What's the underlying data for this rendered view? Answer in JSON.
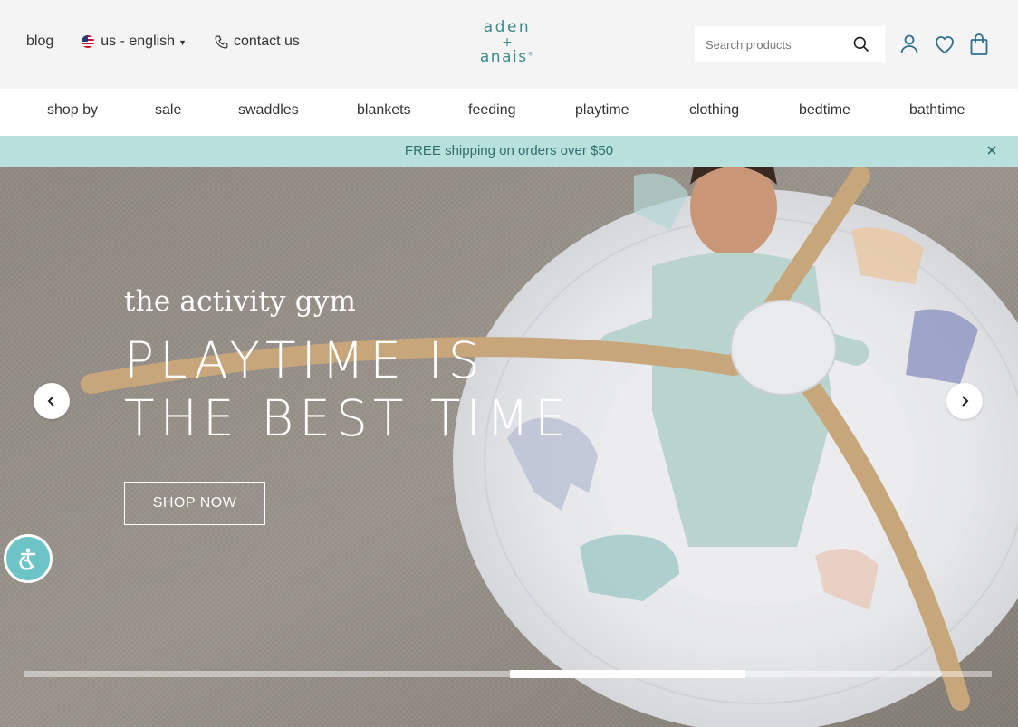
{
  "utility": {
    "blog": "blog",
    "locale": "us - english",
    "contact": "contact us"
  },
  "logo": {
    "line1": "aden",
    "line2": "+",
    "line3": "anais",
    "mark": "®"
  },
  "search": {
    "placeholder": "Search products",
    "icon": "search-icon"
  },
  "icons": {
    "account": "user-icon",
    "wishlist": "heart-icon",
    "cart": "shopping-bag-icon"
  },
  "nav": {
    "items": [
      {
        "label": "shop by"
      },
      {
        "label": "sale"
      },
      {
        "label": "swaddles"
      },
      {
        "label": "blankets"
      },
      {
        "label": "feeding"
      },
      {
        "label": "playtime"
      },
      {
        "label": "clothing"
      },
      {
        "label": "bedtime"
      },
      {
        "label": "bathtime"
      }
    ]
  },
  "promo": {
    "text": "FREE shipping on orders over $50",
    "bg": "#b8e0dc",
    "color": "#2f6f6d"
  },
  "hero": {
    "eyebrow": "the activity gym",
    "title_line1": "PLAYTIME IS",
    "title_line2": "THE BEST TIME",
    "cta": "SHOP NOW",
    "slide_progress": {
      "slides": 4,
      "current": 3
    }
  },
  "colors": {
    "brand": "#3b8b8b",
    "accessibility": "#6cc4c7"
  }
}
